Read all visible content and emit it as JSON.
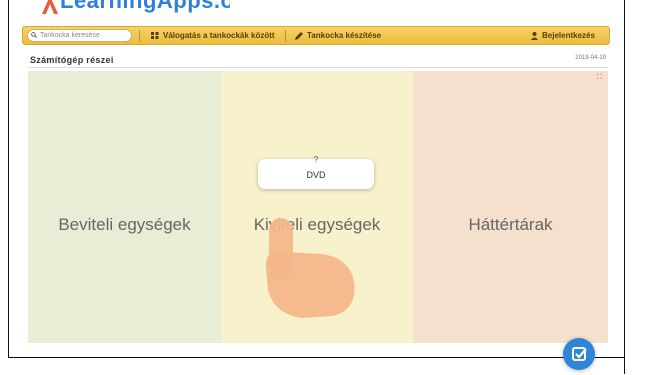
{
  "app": {
    "logo_text": "LearningApps.org"
  },
  "navbar": {
    "search_placeholder": "Tankocka keresése",
    "browse_label": "Válogatás a tankockák között",
    "create_label": "Tankocka készítése",
    "login_label": "Bejelentkezés"
  },
  "page": {
    "title": "Számítógép részei",
    "date": "2019-04-19",
    "fullscreen_glyph": "⛶"
  },
  "columns": [
    {
      "label": "Beviteli egységek",
      "color": "#e8edd6"
    },
    {
      "label": "Kiviteli egységek",
      "color": "#f7f1cc"
    },
    {
      "label": "Háttértárak",
      "color": "#f5dfcd"
    }
  ],
  "card": {
    "question": "?",
    "label": "DVD"
  },
  "colors": {
    "navbar": "#f0c24e",
    "accent_blue": "#2f86d6",
    "hand": "#f4b68a"
  },
  "icons": {
    "search": "search-icon",
    "grid": "grid-icon",
    "pencil": "pencil-icon",
    "user": "user-icon",
    "check": "check-icon",
    "hand": "pointing-hand-icon"
  }
}
